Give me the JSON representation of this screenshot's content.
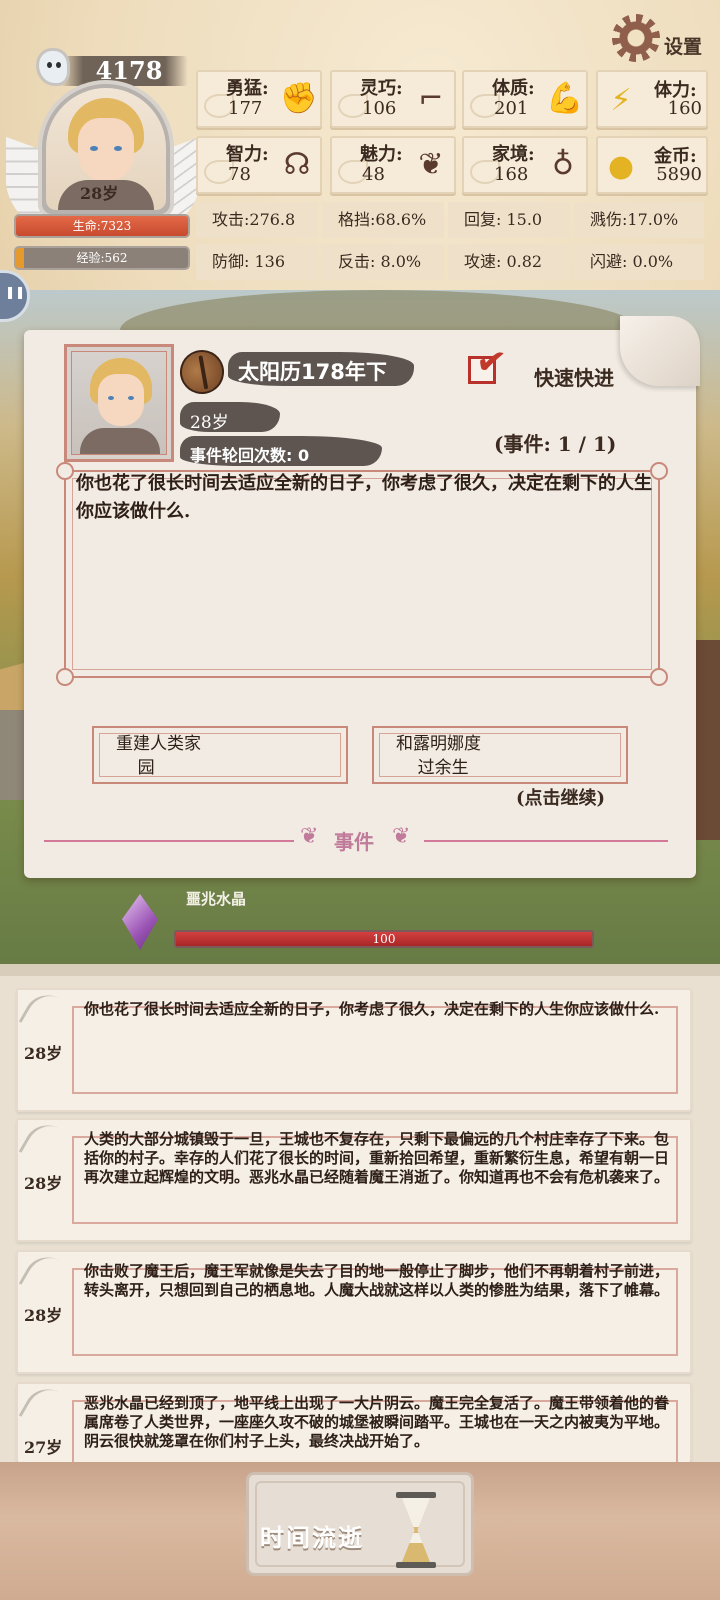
{
  "header": {
    "settings_label": "设置",
    "score": "4178",
    "age": "28岁",
    "hp": "生命:7323",
    "xp": "经验:562"
  },
  "attributes": [
    {
      "name": "勇猛:",
      "value": "177",
      "icon": "fist-icon"
    },
    {
      "name": "灵巧:",
      "value": "106",
      "icon": "leg-icon"
    },
    {
      "name": "体质:",
      "value": "201",
      "icon": "bicep-icon"
    },
    {
      "name": "智力:",
      "value": "78",
      "icon": "brain-icon"
    },
    {
      "name": "魅力:",
      "value": "48",
      "icon": "flower-icon"
    },
    {
      "name": "家境:",
      "value": "168",
      "icon": "money-bag-icon"
    }
  ],
  "resources": [
    {
      "name": "体力:",
      "value": "160",
      "icon": "lightning-icon"
    },
    {
      "name": "金币:",
      "value": "5890",
      "icon": "coin-icon"
    }
  ],
  "combat": [
    [
      "攻击:276.8",
      "格挡:68.6%",
      "回复:  15.0",
      "溅伤:17.0%"
    ],
    [
      "防御:  136",
      "反击:  8.0%",
      "攻速:  0.82",
      "闪避:  0.0%"
    ]
  ],
  "event": {
    "date": "太阳历178年下",
    "fast_forward_label": "快速快进",
    "fast_forward_checked": true,
    "age": "28岁",
    "cycle_label": "事件轮回次数: 0",
    "count_label": "(事件: 1 / 1)",
    "text": "你也花了很长时间去适应全新的日子，你考虑了很久，决定在剩下的人生你应该做什么.",
    "choices": [
      "重建人类家\n    园",
      "和露明娜度\n    过余生"
    ],
    "continue_label": "(点击继续)",
    "section_label": "事件"
  },
  "crystal": {
    "name": "噩兆水晶",
    "value": "100",
    "fill_fraction": 1.0
  },
  "log": [
    {
      "age": "28岁",
      "text": "你也花了很长时间去适应全新的日子，你考虑了很久，决定在剩下的人生你应该做什么."
    },
    {
      "age": "28岁",
      "text": "人类的大部分城镇毁于一旦，王城也不复存在，只剩下最偏远的几个村庄幸存了下来。包括你的村子。幸存的人们花了很长的时间，重新拾回希望，重新繁衍生息，希望有朝一日再次建立起辉煌的文明。恶兆水晶已经随着魔王消逝了。你知道再也不会有危机袭来了。"
    },
    {
      "age": "28岁",
      "text": "你击败了魔王后，魔王军就像是失去了目的地一般停止了脚步，他们不再朝着村子前进，转头离开，只想回到自己的栖息地。人魔大战就这样以人类的惨胜为结果，落下了帷幕。"
    },
    {
      "age": "27岁",
      "text": "恶兆水晶已经到顶了，地平线上出现了一大片阴云。魔王完全复活了。魔王带领着他的眷属席卷了人类世界，一座座久攻不破的城堡被瞬间踏平。王城也在一天之内被夷为平地。阴云很快就笼罩在你们村子上头，最终决战开始了。"
    }
  ],
  "footer": {
    "time_button_label": "时间流逝"
  }
}
